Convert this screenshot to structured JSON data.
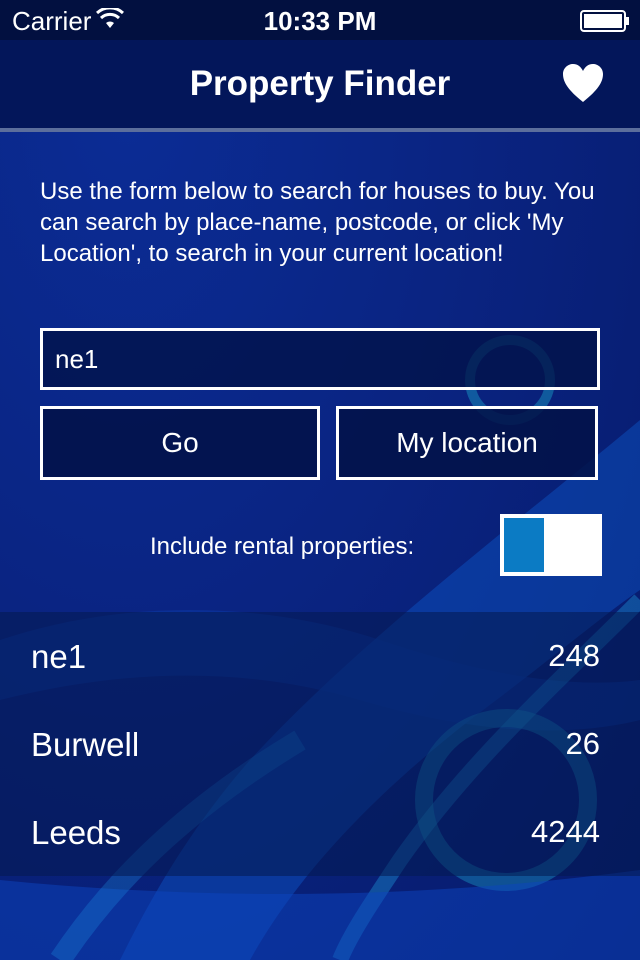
{
  "status_bar": {
    "carrier": "Carrier",
    "time": "10:33 PM",
    "wifi_icon": "wifi-icon",
    "battery_icon": "battery-icon"
  },
  "nav": {
    "title": "Property Finder",
    "favourites_icon": "heart-icon"
  },
  "search": {
    "intro": "Use the form below to search for houses to buy. You can search by place-name, postcode, or click 'My Location', to search in your current location!",
    "value": "ne1",
    "go_label": "Go",
    "my_location_label": "My location"
  },
  "rental_toggle": {
    "label": "Include rental properties:",
    "on": false
  },
  "results": [
    {
      "name": "ne1",
      "count": "248"
    },
    {
      "name": "Burwell",
      "count": "26"
    },
    {
      "name": "Leeds",
      "count": "4244"
    }
  ],
  "colors": {
    "background": "#0a2a9a",
    "nav_background": "#03165a",
    "toggle_accent": "#0b7bc4"
  }
}
